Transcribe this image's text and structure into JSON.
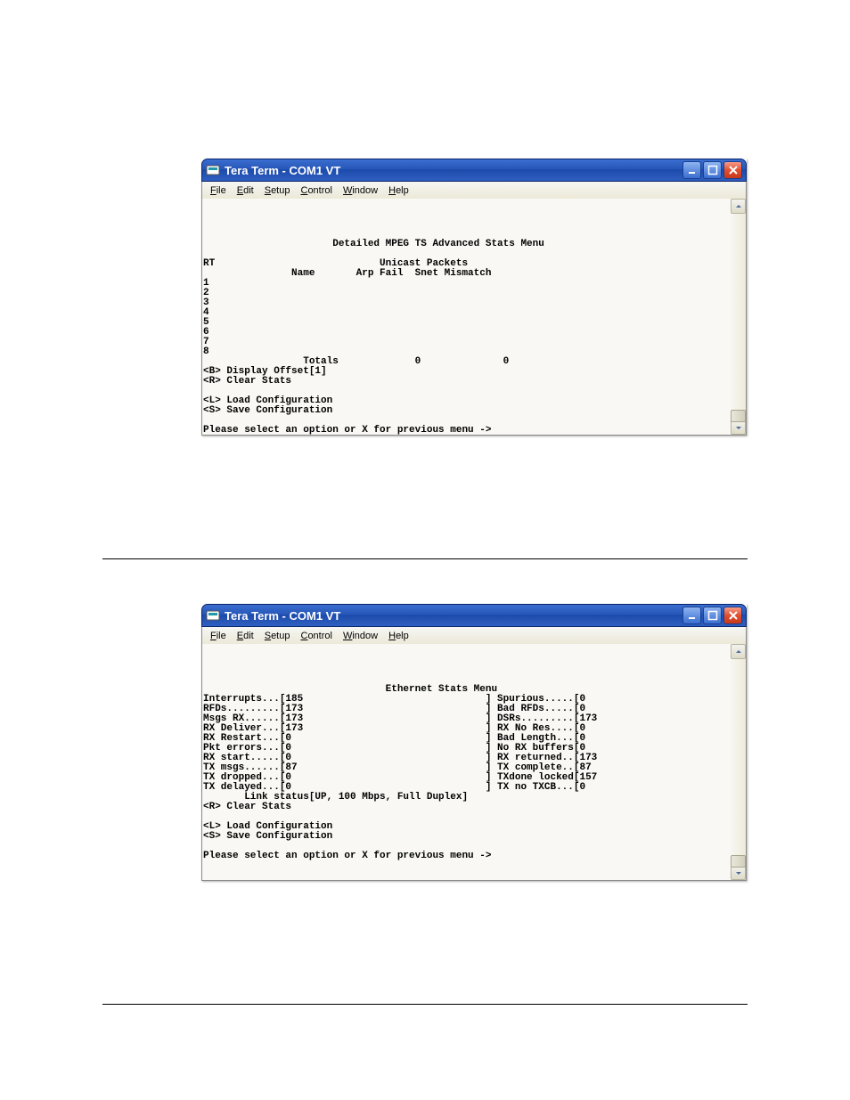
{
  "app": {
    "title": "Tera Term - COM1 VT",
    "menu": {
      "file": "File",
      "edit": "Edit",
      "setup": "Setup",
      "control": "Control",
      "window": "Window",
      "help": "Help"
    }
  },
  "screens": {
    "s1": {
      "title_line": "                      Detailed MPEG TS Advanced Stats Menu",
      "header1": "RT                            Unicast Packets",
      "header2": "               Name       Arp Fail  Snet Mismatch",
      "rows": [
        "1",
        "2",
        "3",
        "4",
        "5",
        "6",
        "7",
        "8"
      ],
      "totals_line": "                 Totals             0              0",
      "opt_b": "<B> Display Offset[1]",
      "opt_r": "<R> Clear Stats",
      "opt_l": "<L> Load Configuration",
      "opt_s": "<S> Save Configuration",
      "prompt": "Please select an option or X for previous menu ->"
    },
    "s2": {
      "title_line": "                               Ethernet Stats Menu",
      "stats": [
        "Interrupts...[185                               ] Spurious.....[0                                 ]",
        "RFDs.........[173                               ] Bad RFDs.....[0                                 ]",
        "Msgs RX......[173                               ] DSRs.........[173                               ]",
        "RX Deliver...[173                               ] RX No Res....[0                                 ]",
        "RX Restart...[0                                 ] Bad Length...[0                                 ]",
        "Pkt errors...[0                                 ] No RX buffers[0                                 ]",
        "RX start.....[0                                 ] RX returned..[173                               ]",
        "TX msgs......[87                                ] TX complete..[87                                ]",
        "TX dropped...[0                                 ] TXdone locked[157                               ]",
        "TX delayed...[0                                 ] TX no TXCB...[0                                 ]"
      ],
      "link_status": "       Link status[UP, 100 Mbps, Full Duplex]",
      "opt_r": "<R> Clear Stats",
      "opt_l": "<L> Load Configuration",
      "opt_s": "<S> Save Configuration",
      "prompt": "Please select an option or X for previous menu ->"
    }
  }
}
